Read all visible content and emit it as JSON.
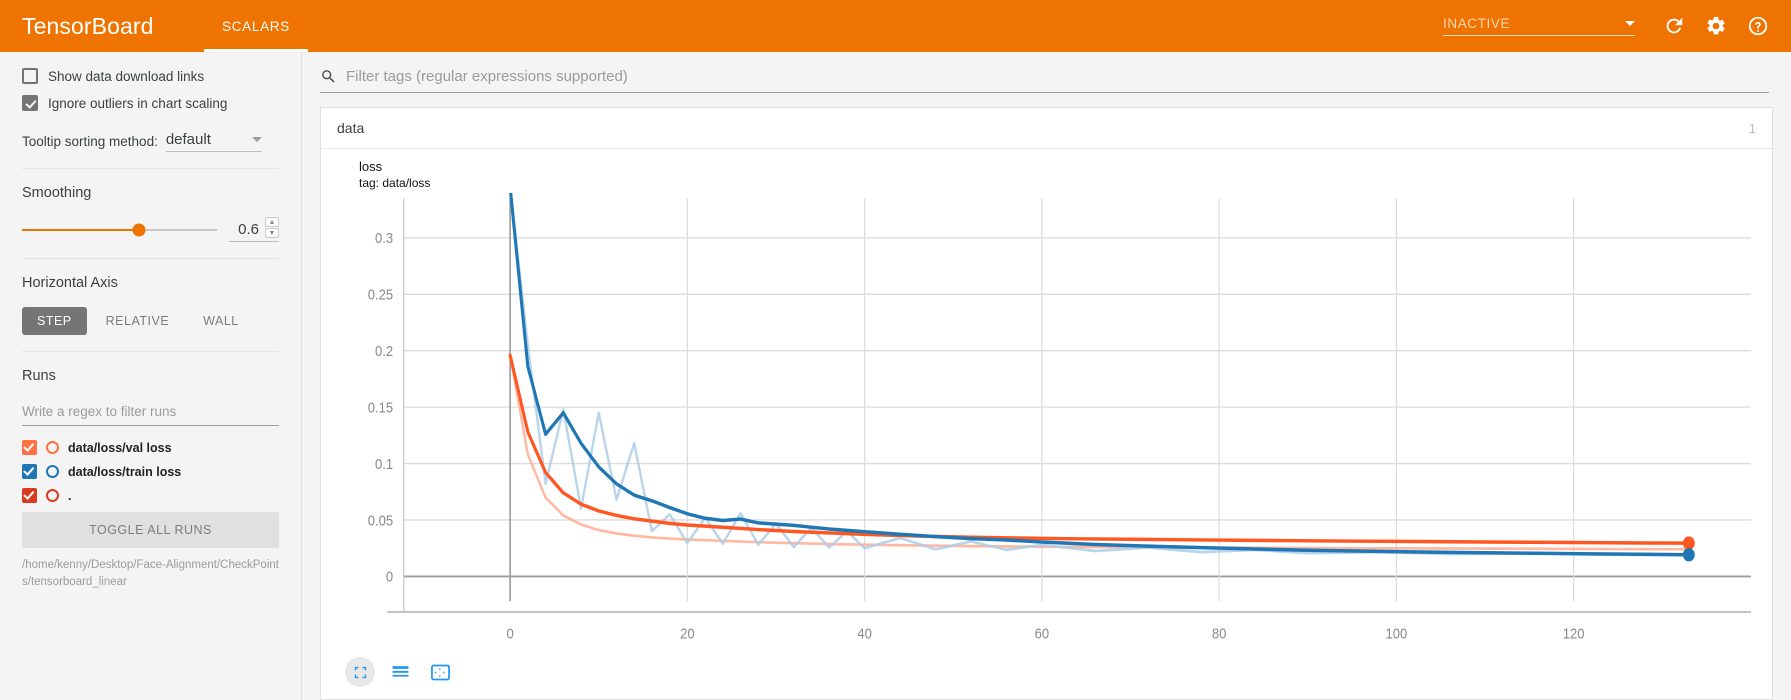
{
  "app": {
    "brand": "TensorBoard",
    "accent": "#ef7300",
    "tabs": [
      {
        "label": "SCALARS",
        "active": true
      }
    ],
    "reload_status": "INACTIVE",
    "icons": {
      "reload": "refresh-icon",
      "settings": "gear-icon",
      "help": "help-icon"
    }
  },
  "sidebar": {
    "checkboxes": [
      {
        "label": "Show data download links",
        "checked": false
      },
      {
        "label": "Ignore outliers in chart scaling",
        "checked": true
      }
    ],
    "tooltip": {
      "label": "Tooltip sorting method:",
      "value": "default"
    },
    "smoothing": {
      "title": "Smoothing",
      "value": "0.6",
      "fraction": 0.6
    },
    "horizontal_axis": {
      "title": "Horizontal Axis",
      "options": [
        {
          "label": "STEP",
          "active": true
        },
        {
          "label": "RELATIVE",
          "active": false
        },
        {
          "label": "WALL",
          "active": false
        }
      ]
    },
    "runs": {
      "title": "Runs",
      "filter_placeholder": "Write a regex to filter runs",
      "filter_value": "",
      "items": [
        {
          "label": "data/loss/val loss",
          "color": "#ff7043",
          "checked": true
        },
        {
          "label": "data/loss/train loss",
          "color": "#1f77b4",
          "checked": true
        },
        {
          "label": ".",
          "color": "#d93b1f",
          "checked": true
        }
      ],
      "toggle_all": "TOGGLE ALL RUNS",
      "logdir": "/home/kenny/Desktop/Face-Alignment/CheckPoints/tensorboard_linear"
    }
  },
  "main": {
    "filter_placeholder": "Filter tags (regular expressions supported)",
    "filter_value": "",
    "search_icon": "search-icon",
    "group": {
      "name": "data",
      "count": "1"
    },
    "chart_controls": [
      {
        "name": "expand-chart-button",
        "icon": "expand-icon",
        "highlighted": true
      },
      {
        "name": "toggle-y-axis-button",
        "icon": "lines-icon",
        "highlighted": false
      },
      {
        "name": "fit-domain-button",
        "icon": "fit-icon",
        "highlighted": false
      }
    ]
  },
  "chart_data": {
    "type": "line",
    "title": "loss",
    "subtitle": "tag: data/loss",
    "xlabel": "",
    "ylabel": "",
    "xlim": [
      -12,
      140
    ],
    "ylim": [
      -0.022,
      0.335
    ],
    "xticks": [
      0,
      20,
      40,
      60,
      80,
      100,
      120
    ],
    "yticks": [
      0,
      0.05,
      0.1,
      0.15,
      0.2,
      0.25,
      0.3
    ],
    "grid": true,
    "legend_position": "none",
    "smoothing": 0.6,
    "series": [
      {
        "name": "data/loss/val loss",
        "color": "#ff5722",
        "style": "smoothed",
        "x": [
          0,
          2,
          4,
          6,
          8,
          10,
          12,
          14,
          16,
          18,
          20,
          24,
          28,
          32,
          36,
          40,
          46,
          52,
          58,
          64,
          70,
          78,
          86,
          94,
          102,
          110,
          118,
          126,
          133
        ],
        "values": [
          0.196,
          0.128,
          0.092,
          0.074,
          0.064,
          0.058,
          0.054,
          0.051,
          0.049,
          0.047,
          0.0455,
          0.0435,
          0.0415,
          0.0398,
          0.0385,
          0.0372,
          0.0358,
          0.0347,
          0.0339,
          0.0333,
          0.0329,
          0.0323,
          0.0318,
          0.0313,
          0.0309,
          0.0305,
          0.0301,
          0.0297,
          0.0295
        ]
      },
      {
        "name": "data/loss/val loss (raw)",
        "color": "#ffab91",
        "style": "raw",
        "x": [
          0,
          2,
          4,
          6,
          8,
          10,
          12,
          14,
          16,
          18,
          20,
          24,
          28,
          32,
          36,
          40,
          46,
          52,
          58,
          64,
          70,
          78,
          86,
          94,
          102,
          110,
          118,
          126,
          133
        ],
        "values": [
          0.196,
          0.108,
          0.07,
          0.054,
          0.046,
          0.041,
          0.038,
          0.036,
          0.0345,
          0.0335,
          0.0327,
          0.0315,
          0.0303,
          0.0294,
          0.0287,
          0.0281,
          0.0274,
          0.0268,
          0.0264,
          0.0261,
          0.0259,
          0.0256,
          0.0253,
          0.025,
          0.0248,
          0.0246,
          0.0244,
          0.0242,
          0.0241
        ]
      },
      {
        "name": "data/loss/train loss",
        "color": "#1f77b4",
        "style": "smoothed",
        "x": [
          0,
          2,
          4,
          6,
          8,
          10,
          12,
          14,
          16,
          18,
          20,
          22,
          24,
          26,
          28,
          30,
          32,
          34,
          36,
          38,
          40,
          44,
          48,
          52,
          56,
          60,
          66,
          72,
          78,
          84,
          90,
          98,
          106,
          114,
          122,
          130,
          133
        ],
        "values": [
          0.345,
          0.186,
          0.126,
          0.145,
          0.118,
          0.097,
          0.082,
          0.072,
          0.067,
          0.061,
          0.0555,
          0.0515,
          0.0495,
          0.0508,
          0.0474,
          0.0463,
          0.0452,
          0.0436,
          0.042,
          0.0408,
          0.0396,
          0.0373,
          0.0352,
          0.0335,
          0.0322,
          0.0305,
          0.0283,
          0.0268,
          0.0255,
          0.0243,
          0.0232,
          0.0222,
          0.0213,
          0.0206,
          0.02,
          0.0194,
          0.0192
        ]
      },
      {
        "name": "data/loss/train loss (raw)",
        "color": "#aecde8",
        "style": "raw",
        "x": [
          0,
          2,
          4,
          6,
          8,
          10,
          12,
          14,
          16,
          18,
          20,
          22,
          24,
          26,
          28,
          30,
          32,
          34,
          36,
          38,
          40,
          44,
          48,
          52,
          56,
          60,
          66,
          72,
          78,
          84,
          90,
          98,
          106,
          114,
          122,
          130,
          133
        ],
        "values": [
          0.345,
          0.205,
          0.082,
          0.148,
          0.06,
          0.145,
          0.068,
          0.118,
          0.04,
          0.055,
          0.0295,
          0.052,
          0.029,
          0.056,
          0.028,
          0.047,
          0.026,
          0.043,
          0.0255,
          0.04,
          0.025,
          0.034,
          0.024,
          0.031,
          0.0235,
          0.028,
          0.0225,
          0.0255,
          0.0215,
          0.0235,
          0.0205,
          0.0215,
          0.0198,
          0.0205,
          0.0192,
          0.019,
          0.0188
        ]
      }
    ],
    "endpoints": [
      {
        "series": "data/loss/val loss",
        "x": 133,
        "y": 0.0295,
        "color": "#ff5722"
      },
      {
        "series": "data/loss/train loss",
        "x": 133,
        "y": 0.0192,
        "color": "#1f77b4"
      }
    ]
  }
}
